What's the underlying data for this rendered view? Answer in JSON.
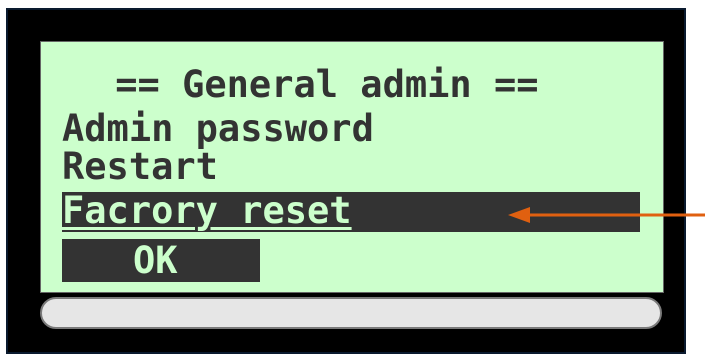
{
  "menu": {
    "title": " == General admin ==",
    "items": [
      {
        "label": "Admin password"
      },
      {
        "label": "Restart"
      },
      {
        "label": "Facrory reset",
        "selected": true
      }
    ],
    "ok_label": "OK"
  },
  "colors": {
    "screen_bg": "#ccffcc",
    "text": "#333333",
    "highlight_bg": "#333333",
    "highlight_text": "#ccffcc",
    "arrow": "#e06010",
    "frame": "#000000"
  },
  "icons": {
    "pointer": "arrow-left-icon"
  }
}
